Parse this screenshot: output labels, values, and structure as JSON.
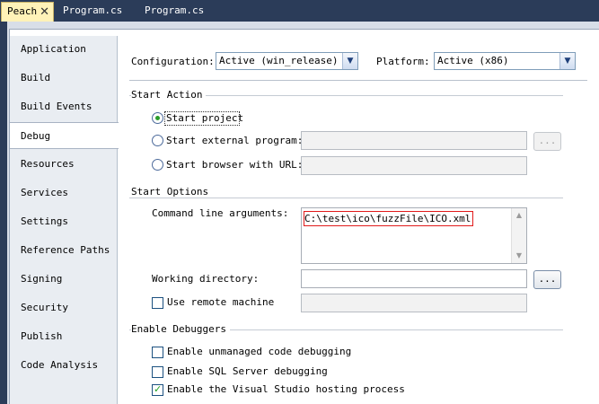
{
  "tabs": [
    {
      "label": "Peach",
      "close": "✕"
    },
    {
      "label": "Program.cs"
    },
    {
      "label": "Program.cs"
    }
  ],
  "nav": {
    "items": [
      "Application",
      "Build",
      "Build Events",
      "Debug",
      "Resources",
      "Services",
      "Settings",
      "Reference Paths",
      "Signing",
      "Security",
      "Publish",
      "Code Analysis"
    ],
    "selected": "Debug"
  },
  "config": {
    "configuration_label": "Configuration:",
    "configuration_value": "Active (win_release)",
    "platform_label": "Platform:",
    "platform_value": "Active (x86)"
  },
  "start_action": {
    "title": "Start Action",
    "start_project": "Start project",
    "start_external": "Start external program:",
    "start_browser": "Start browser with URL:",
    "browse_button": "..."
  },
  "start_options": {
    "title": "Start Options",
    "cmd_label": "Command line arguments:",
    "cmd_value": "C:\\test\\ico\\fuzzFile\\ICO.xml",
    "workdir_label": "Working directory:",
    "workdir_button": "...",
    "remote_label": "Use remote machine"
  },
  "debuggers": {
    "title": "Enable Debuggers",
    "unmanaged": "Enable unmanaged code debugging",
    "sql": "Enable SQL Server debugging",
    "hosting": "Enable the Visual Studio hosting process"
  },
  "colors": {
    "accent_bg": "#2b3c59",
    "active_tab": "#fff2b8",
    "highlight_border": "#e11a1a"
  },
  "icons": {
    "close": "close-icon",
    "dropdown": "chevron-down-icon",
    "scroll_up": "scroll-up-icon",
    "scroll_down": "scroll-down-icon"
  }
}
